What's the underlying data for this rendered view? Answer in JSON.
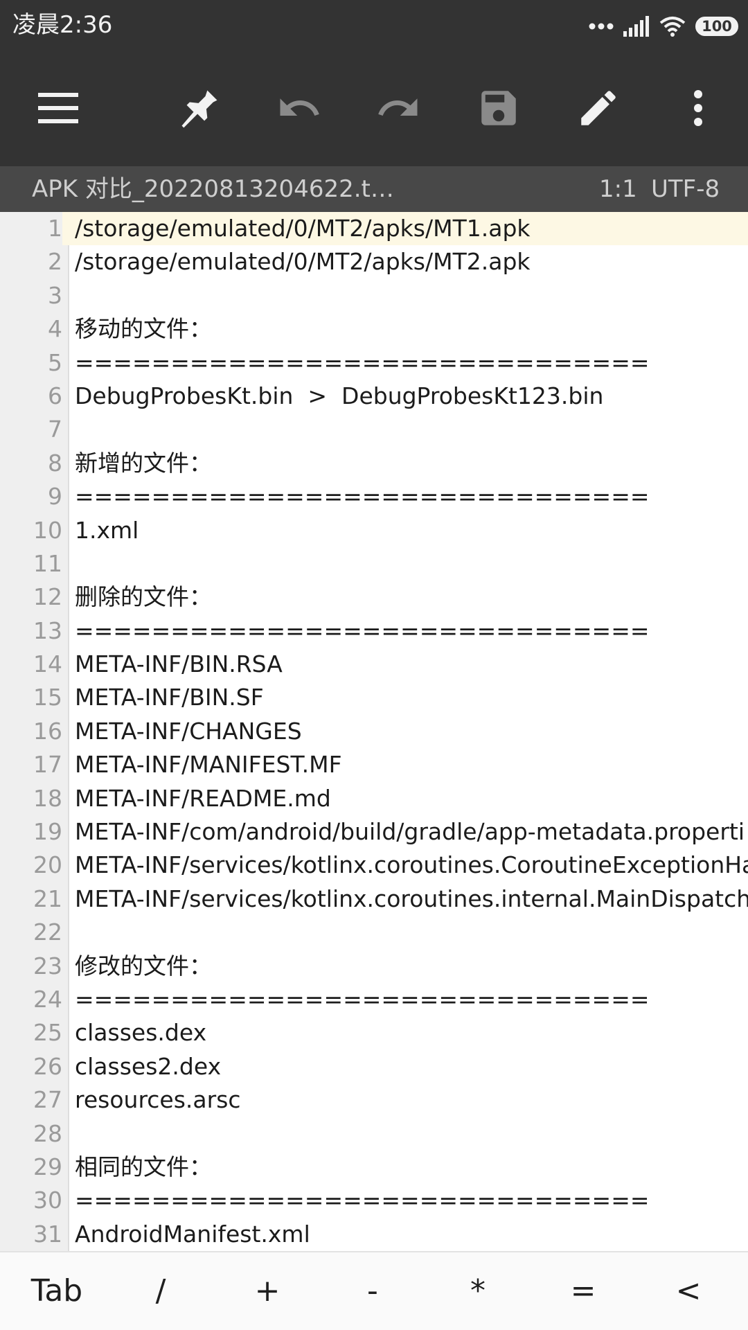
{
  "status_bar": {
    "time": "凌晨2:36",
    "battery": "100"
  },
  "toolbar": {
    "icons": [
      "menu-icon",
      "pin-icon",
      "undo-icon",
      "redo-icon",
      "save-icon",
      "edit-icon",
      "more-vert-icon"
    ]
  },
  "info_bar": {
    "file_name": "APK 对比_20220813204622.t…",
    "cursor_position": "1:1",
    "encoding": "UTF-8"
  },
  "editor": {
    "current_line": 1,
    "lines": [
      {
        "num": "1",
        "text": "/storage/emulated/0/MT2/apks/MT1.apk"
      },
      {
        "num": "2",
        "text": "/storage/emulated/0/MT2/apks/MT2.apk"
      },
      {
        "num": "3",
        "text": ""
      },
      {
        "num": "4",
        "text": "移动的文件："
      },
      {
        "num": "5",
        "text": "=============================="
      },
      {
        "num": "6",
        "text": "DebugProbesKt.bin  >  DebugProbesKt123.bin"
      },
      {
        "num": "7",
        "text": ""
      },
      {
        "num": "8",
        "text": "新增的文件："
      },
      {
        "num": "9",
        "text": "=============================="
      },
      {
        "num": "10",
        "text": "1.xml"
      },
      {
        "num": "11",
        "text": ""
      },
      {
        "num": "12",
        "text": "删除的文件："
      },
      {
        "num": "13",
        "text": "=============================="
      },
      {
        "num": "14",
        "text": "META-INF/BIN.RSA"
      },
      {
        "num": "15",
        "text": "META-INF/BIN.SF"
      },
      {
        "num": "16",
        "text": "META-INF/CHANGES"
      },
      {
        "num": "17",
        "text": "META-INF/MANIFEST.MF"
      },
      {
        "num": "18",
        "text": "META-INF/README.md"
      },
      {
        "num": "19",
        "text": "META-INF/com/android/build/gradle/app-metadata.properti"
      },
      {
        "num": "20",
        "text": "META-INF/services/kotlinx.coroutines.CoroutineExceptionHa"
      },
      {
        "num": "21",
        "text": "META-INF/services/kotlinx.coroutines.internal.MainDispatch"
      },
      {
        "num": "22",
        "text": ""
      },
      {
        "num": "23",
        "text": "修改的文件："
      },
      {
        "num": "24",
        "text": "=============================="
      },
      {
        "num": "25",
        "text": "classes.dex"
      },
      {
        "num": "26",
        "text": "classes2.dex"
      },
      {
        "num": "27",
        "text": "resources.arsc"
      },
      {
        "num": "28",
        "text": ""
      },
      {
        "num": "29",
        "text": "相同的文件："
      },
      {
        "num": "30",
        "text": "=============================="
      },
      {
        "num": "31",
        "text": "AndroidManifest.xml"
      }
    ]
  },
  "symbol_bar": {
    "keys": [
      "Tab",
      "/",
      "+",
      "-",
      "*",
      "=",
      "<"
    ]
  }
}
